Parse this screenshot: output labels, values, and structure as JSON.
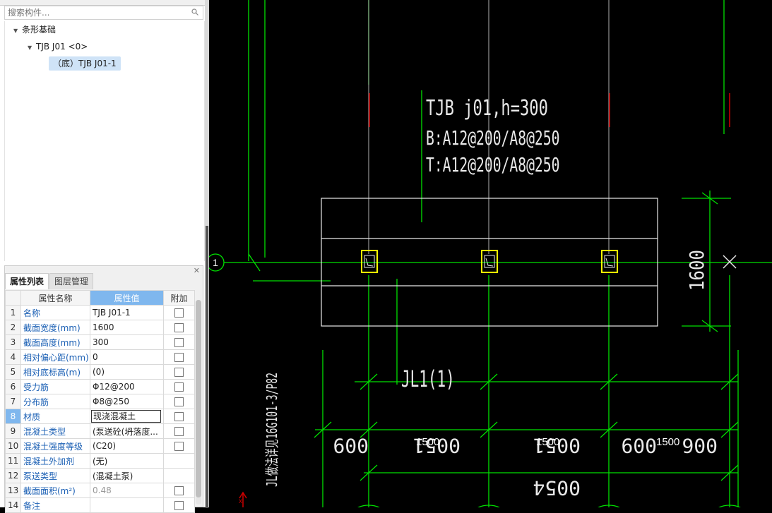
{
  "search": {
    "placeholder": "搜索构件..."
  },
  "tree": {
    "root": "条形基础",
    "child": "TJB J01 <0>",
    "leaf": "（底）TJB J01-1"
  },
  "panel": {
    "tabs": [
      "属性列表",
      "图层管理"
    ],
    "headers": {
      "name": "属性名称",
      "value": "属性值",
      "extra": "附加"
    },
    "rows": [
      {
        "n": "1",
        "name": "名称",
        "value": "TJB J01-1"
      },
      {
        "n": "2",
        "name": "截面宽度(mm)",
        "value": "1600"
      },
      {
        "n": "3",
        "name": "截面高度(mm)",
        "value": "300"
      },
      {
        "n": "4",
        "name": "相对偏心距(mm)",
        "value": "0"
      },
      {
        "n": "5",
        "name": "相对底标高(m)",
        "value": "(0)"
      },
      {
        "n": "6",
        "name": "受力筋",
        "value": "Φ12@200"
      },
      {
        "n": "7",
        "name": "分布筋",
        "value": "Φ8@250"
      },
      {
        "n": "8",
        "name": "材质",
        "value": "现浇混凝土"
      },
      {
        "n": "9",
        "name": "混凝土类型",
        "value": "(泵送砼(坍落度..."
      },
      {
        "n": "10",
        "name": "混凝土强度等级",
        "value": "(C20)"
      },
      {
        "n": "11",
        "name": "混凝土外加剂",
        "value": "(无)"
      },
      {
        "n": "12",
        "name": "泵送类型",
        "value": "(混凝土泵)"
      },
      {
        "n": "13",
        "name": "截面面积(m²)",
        "value": "0.48"
      },
      {
        "n": "14",
        "name": "备注",
        "value": ""
      }
    ]
  },
  "cad": {
    "label_title": "TJB   j01,h=300",
    "label_bottom": "B:A12@200/A8@250",
    "label_top": "T:A12@200/A8@250",
    "dim_height": "1600",
    "axis_label": "1",
    "beam_label": "JL1(1)",
    "side_note": "JL做法详见16G101-3/P82",
    "dims_mirrored": [
      "009",
      "0051",
      "0051",
      "009",
      "006"
    ],
    "dims_overlay": [
      "1500",
      "1500",
      "1500"
    ],
    "dim_total": "0054",
    "colors": {
      "green": "#00e000",
      "white": "#e8e8e8",
      "yellow": "#ffff00",
      "red": "#d00000"
    }
  }
}
